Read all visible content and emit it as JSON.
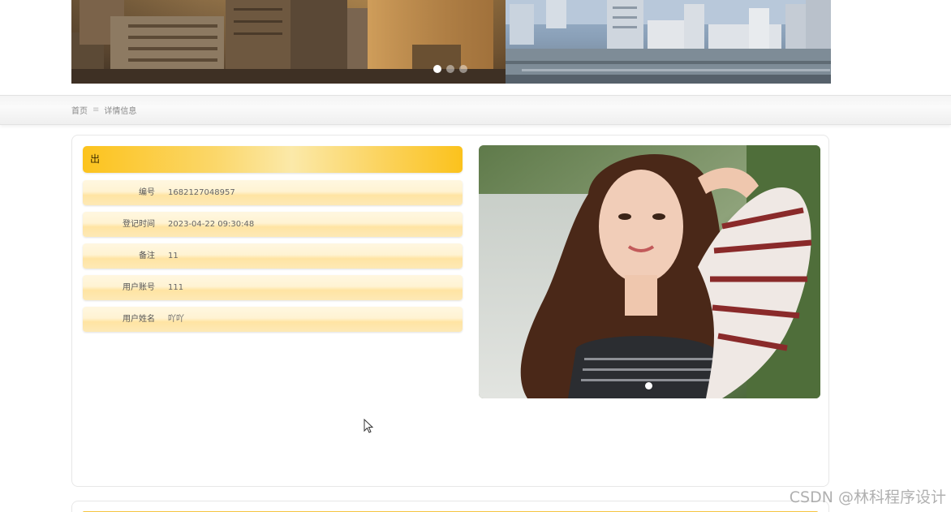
{
  "banner": {
    "slides": 3,
    "active_slide": 1
  },
  "breadcrumb": {
    "home": "首页",
    "separator": "≡",
    "current": "详情信息"
  },
  "detail": {
    "title": "出",
    "fields": [
      {
        "label": "编号",
        "value": "1682127048957"
      },
      {
        "label": "登记时间",
        "value": "2023-04-22 09:30:48"
      },
      {
        "label": "备注",
        "value": "11"
      },
      {
        "label": "用户账号",
        "value": "111"
      },
      {
        "label": "用户姓名",
        "value": "吖吖"
      }
    ]
  },
  "photo": {
    "slides": 1,
    "active_slide": 1
  },
  "watermark": "CSDN @林科程序设计",
  "colors": {
    "accent": "#fcc31d",
    "row_bg": "#ffe4a3"
  }
}
